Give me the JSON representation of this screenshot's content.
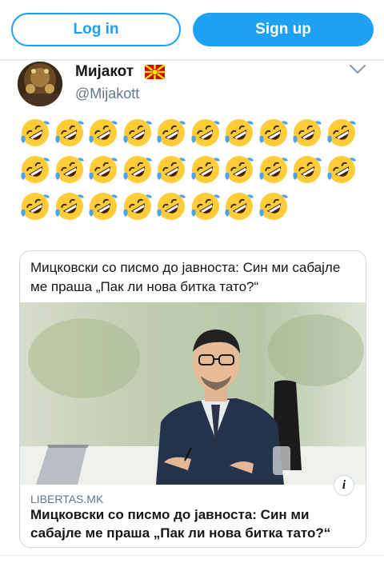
{
  "header": {
    "login_label": "Log in",
    "signup_label": "Sign up"
  },
  "tweet": {
    "author_name": "Мијакот",
    "author_handle": "@Mijakott",
    "flag_icon": "north-macedonia-flag-icon",
    "emoji_icon": "rolling-on-the-floor-laughing-emoji",
    "emoji_rows": [
      10,
      10,
      8
    ]
  },
  "card": {
    "top_title": "Мицковски со писмо до јавноста: Син ми сабајле ме праша „Пак ли нова битка тато?“",
    "domain": "LIBERTAS.MK",
    "title": "Мицковски со писмо до јавноста: Син ми сабајле ме праша „Пак ли нова битка тато?“",
    "info_label": "i"
  },
  "colors": {
    "accent": "#1da1f2",
    "secondary_text": "#657786",
    "border": "#ccd6dd",
    "flag_red": "#d20000",
    "flag_yellow": "#ffe600"
  }
}
